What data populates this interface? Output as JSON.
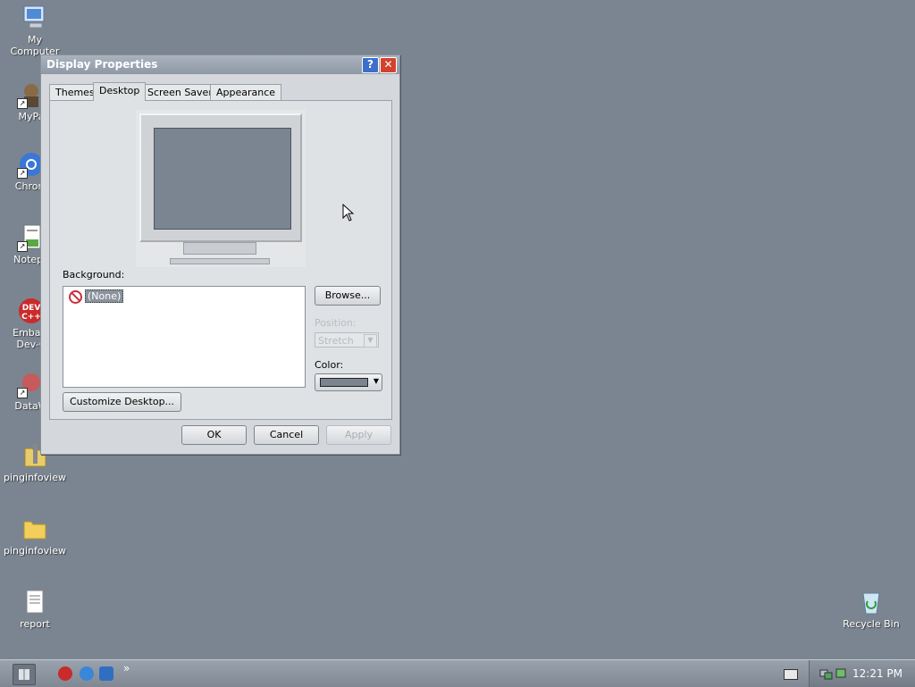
{
  "desktop": {
    "icons": [
      {
        "label": "My Computer",
        "icon": "computer-icon"
      },
      {
        "label": "MyPa",
        "icon": "user-shortcut-icon"
      },
      {
        "label": "Chrom",
        "icon": "chrome-icon"
      },
      {
        "label": "Notepa",
        "icon": "notepad-icon"
      },
      {
        "label": "Embarc Dev-C",
        "icon": "devcpp-icon"
      },
      {
        "label": "DataW",
        "icon": "datawarehouse-icon"
      },
      {
        "label": "pinginfoview",
        "icon": "zip-file-icon"
      },
      {
        "label": "pinginfoview",
        "icon": "folder-icon"
      },
      {
        "label": "report",
        "icon": "text-document-icon"
      },
      {
        "label": "Recycle Bin",
        "icon": "recycle-bin-icon"
      }
    ]
  },
  "window": {
    "title": "Display Properties",
    "help_glyph": "?",
    "close_glyph": "✕",
    "tabs": [
      "Themes",
      "Desktop",
      "Screen Saver",
      "Appearance"
    ],
    "active_tab": "Desktop",
    "background_label": "Background:",
    "background_items": [
      "(None)"
    ],
    "browse_label": "Browse...",
    "position_label": "Position:",
    "position_value": "Stretch",
    "color_label": "Color:",
    "color_value": "#7a8591",
    "customize_label": "Customize Desktop...",
    "ok_label": "OK",
    "cancel_label": "Cancel",
    "apply_label": "Apply"
  },
  "taskbar": {
    "quicklaunch_overflow": "»",
    "clock": "12:21 PM"
  },
  "colors": {
    "desktop_bg": "#7a8591",
    "titlebar": "#9aa3ae",
    "close_button": "#d2432e"
  }
}
